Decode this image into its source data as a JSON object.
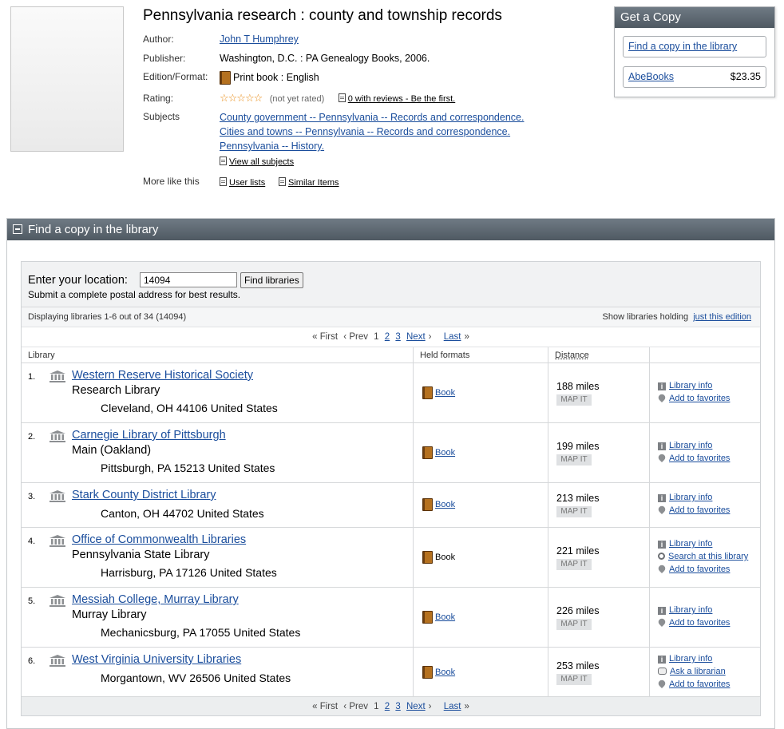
{
  "book": {
    "title": "Pennsylvania research : county and township records",
    "author_label": "Author:",
    "author": "John T Humphrey",
    "publisher_label": "Publisher:",
    "publisher": "Washington, D.C. : PA Genealogy Books, 2006.",
    "edition_label": "Edition/Format:",
    "edition": "Print book : English",
    "rating_label": "Rating:",
    "rating_stars": "☆☆☆☆☆",
    "rating_status": "(not yet rated)",
    "reviews_link": "0 with reviews - Be the first.",
    "subjects_label": "Subjects",
    "subjects": [
      "County government -- Pennsylvania -- Records and correspondence.",
      "Cities and towns -- Pennsylvania -- Records and correspondence.",
      "Pennsylvania -- History."
    ],
    "view_all_subjects": "View all subjects",
    "more_like_label": "More like this",
    "user_lists": "User lists",
    "similar_items": "Similar Items"
  },
  "get_copy": {
    "title": "Get a Copy",
    "find_library": "Find a copy in the library",
    "vendor": "AbeBooks",
    "price": "$23.35"
  },
  "library_section": {
    "title": "Find a copy in the library",
    "location_label": "Enter your location:",
    "location_value": "14094",
    "find_button": "Find libraries",
    "hint": "Submit a complete postal address for best results.",
    "displaying": "Displaying libraries 1-6 out of 34 (14094)",
    "show_holding_label": "Show libraries holding",
    "show_holding_link": "just this edition",
    "pager": {
      "first": "« First",
      "prev": "‹ Prev",
      "p1": "1",
      "p2": "2",
      "p3": "3",
      "next": "Next",
      "next_arrow": "›",
      "last": "Last",
      "last_arrow": "»"
    },
    "columns": {
      "library": "Library",
      "formats": "Held formats",
      "distance": "Distance"
    },
    "map_it": "MAP IT",
    "libraries": [
      {
        "num": "1.",
        "name": "Western Reserve Historical Society",
        "branch": "Research Library",
        "address": "Cleveland, OH 44106 United States",
        "format": "Book",
        "format_link": true,
        "distance": "188 miles",
        "actions": [
          "Library info",
          "Add to favorites"
        ]
      },
      {
        "num": "2.",
        "name": "Carnegie Library of Pittsburgh",
        "branch": "Main (Oakland)",
        "address": "Pittsburgh, PA 15213 United States",
        "format": "Book",
        "format_link": true,
        "distance": "199 miles",
        "actions": [
          "Library info",
          "Add to favorites"
        ]
      },
      {
        "num": "3.",
        "name": "Stark County District Library",
        "branch": "",
        "address": "Canton, OH 44702 United States",
        "format": "Book",
        "format_link": true,
        "distance": "213 miles",
        "actions": [
          "Library info",
          "Add to favorites"
        ]
      },
      {
        "num": "4.",
        "name": "Office of Commonwealth Libraries",
        "branch": "Pennsylvania State Library",
        "address": "Harrisburg, PA 17126 United States",
        "format": "Book",
        "format_link": false,
        "distance": "221 miles",
        "actions": [
          "Library info",
          "Search at this library",
          "Add to favorites"
        ]
      },
      {
        "num": "5.",
        "name": "Messiah College, Murray Library",
        "branch": "Murray Library",
        "address": "Mechanicsburg, PA 17055 United States",
        "format": "Book",
        "format_link": true,
        "distance": "226 miles",
        "actions": [
          "Library info",
          "Add to favorites"
        ]
      },
      {
        "num": "6.",
        "name": "West Virginia University Libraries",
        "branch": "",
        "address": "Morgantown, WV 26506 United States",
        "format": "Book",
        "format_link": true,
        "distance": "253 miles",
        "actions": [
          "Library info",
          "Ask a librarian",
          "Add to favorites"
        ]
      }
    ]
  },
  "icons": {
    "collapse": "minus-box-icon",
    "library": "library-building-icon",
    "book": "book-icon",
    "info": "info-icon",
    "favorite": "heart-icon",
    "search": "search-icon",
    "ask": "chat-bubble-icon",
    "doc": "document-icon"
  }
}
